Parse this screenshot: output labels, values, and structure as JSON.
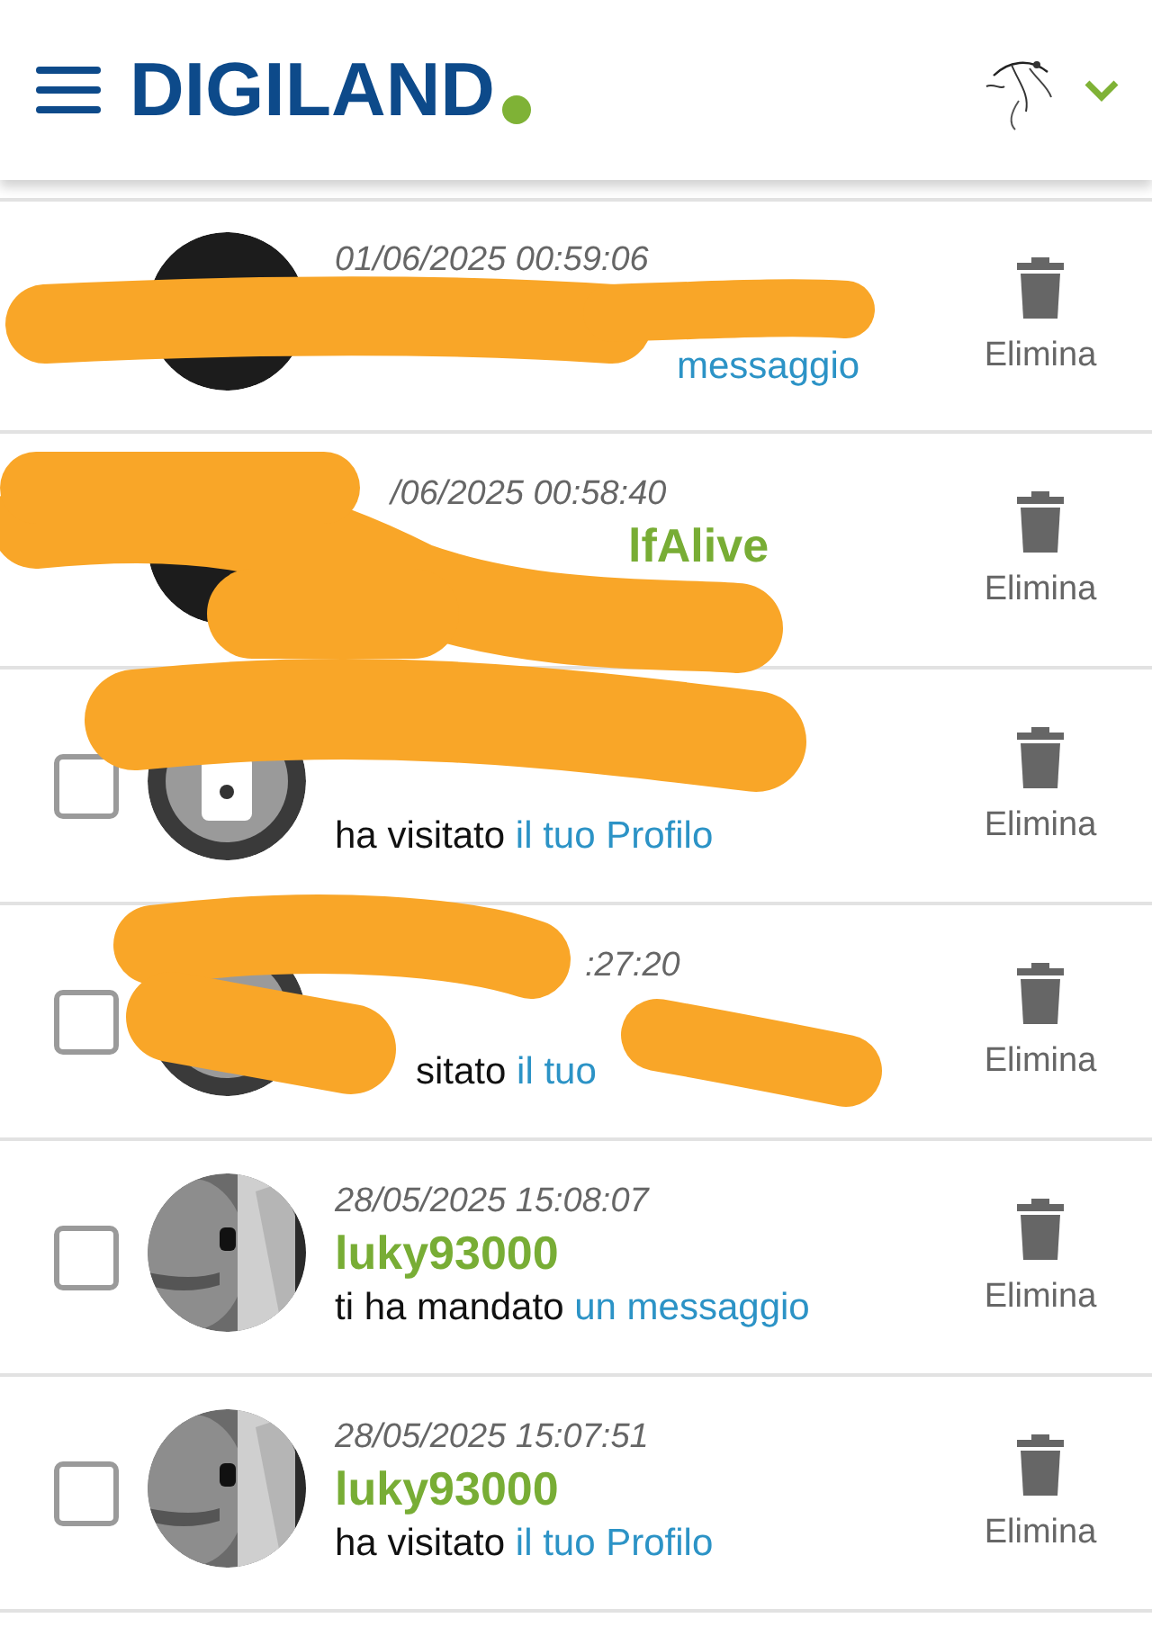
{
  "header": {
    "logo": "DIGILAND"
  },
  "rows": [
    {
      "avatar": {
        "kind": "dark"
      },
      "scribbled": true,
      "time": "01/06/2025 00:59:06",
      "link": "messaggio",
      "delete": "Elimina"
    },
    {
      "avatar": {
        "kind": "dark"
      },
      "scribbled": true,
      "time": "/06/2025 00:58:40",
      "user": "lfAlive",
      "delete": "Elimina"
    },
    {
      "avatar": {
        "kind": "default"
      },
      "scribbled": true,
      "checked": false,
      "action": "ha visitato",
      "link": "il tuo Profilo",
      "delete": "Elimina"
    },
    {
      "avatar": {
        "kind": "default"
      },
      "scribbled": true,
      "checked": false,
      "time": ":27:20",
      "action": "sitato",
      "link": "il tuo",
      "delete": "Elimina"
    },
    {
      "scribbled": false,
      "checked": false,
      "time": "28/05/2025 15:08:07",
      "user": "luky93000",
      "action": "ti ha mandato",
      "link": "un messaggio",
      "delete": "Elimina"
    },
    {
      "scribbled": false,
      "checked": false,
      "time": "28/05/2025 15:07:51",
      "user": "luky93000",
      "action": "ha visitato",
      "link": "il tuo Profilo",
      "delete": "Elimina"
    }
  ]
}
